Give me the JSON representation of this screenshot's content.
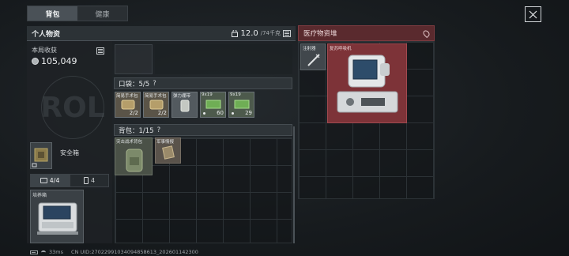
{
  "tabs": [
    {
      "label": "背包",
      "active": true
    },
    {
      "label": "健康",
      "active": false
    }
  ],
  "personal": {
    "title": "个人物资",
    "weight_value": "12.0",
    "weight_max": "/74千克"
  },
  "earnings": {
    "label": "本局收获",
    "value": "105,049"
  },
  "safe_box": {
    "label": "安全箱"
  },
  "left_tabs": [
    {
      "label": "4/4",
      "icon": "medkit-icon",
      "active": true
    },
    {
      "label": "4",
      "icon": "phone-icon",
      "active": false
    }
  ],
  "equipped_item": {
    "label": "培养箱"
  },
  "pocket": {
    "title": "口袋：5/5",
    "help": "?",
    "items": [
      {
        "name": "简易手术包",
        "count": "2/2",
        "color": "#8a7a55"
      },
      {
        "name": "简易手术包",
        "count": "2/2",
        "color": "#8a7a55"
      },
      {
        "name": "弹力绷带",
        "count": "",
        "color": "#6f7a78"
      },
      {
        "name": "9x19",
        "count": "60",
        "color": "#4f7a45"
      },
      {
        "name": "9x19",
        "count": "29",
        "color": "#4f7a45"
      }
    ]
  },
  "backpack": {
    "title": "背包：1/15",
    "help": "?",
    "items": [
      {
        "name": "突击战术背包",
        "count": "",
        "color": "#5e6a52"
      },
      {
        "name": "军事情报",
        "count": "",
        "color": "#7a6a58"
      }
    ]
  },
  "medical": {
    "title": "医疗物资堆",
    "items": [
      {
        "name": "注射器",
        "color": "#4a5055"
      },
      {
        "name": "复苏呼吸机",
        "color": "#8a3a3e"
      }
    ]
  },
  "footer": {
    "ping": "33ms",
    "uid": "CN UID:27022991034094858613_202601142300"
  },
  "emblem_text": "ROL",
  "colors": {
    "medical_accent": "#5a2a2e",
    "active_tab": "#4a5157"
  }
}
